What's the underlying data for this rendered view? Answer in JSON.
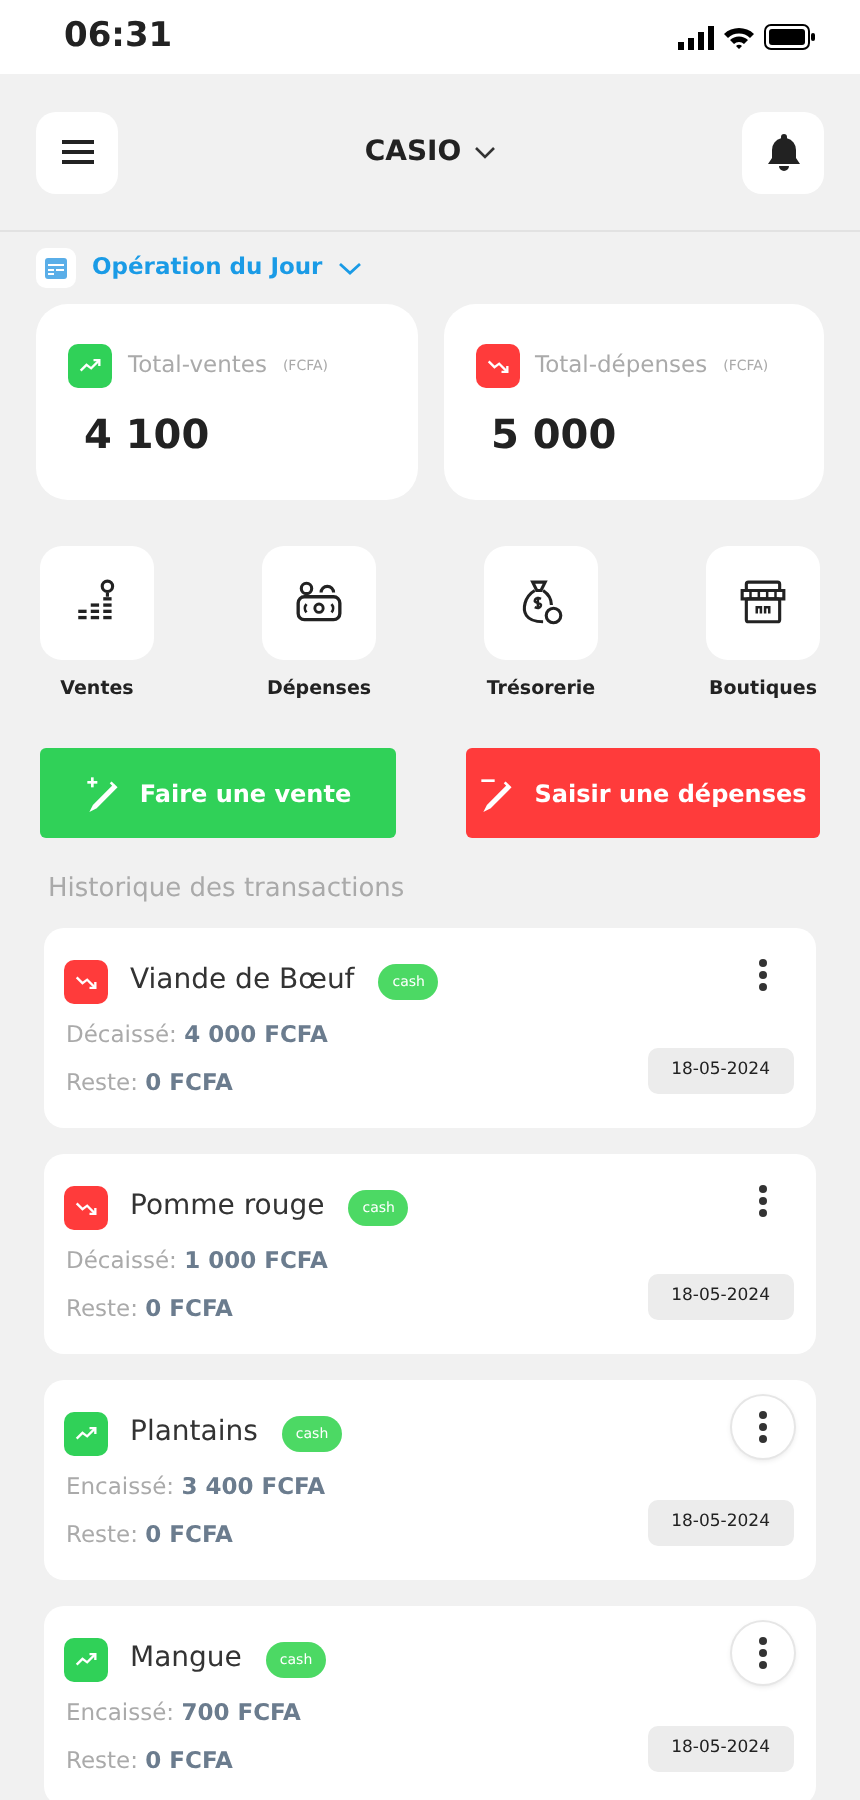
{
  "status_bar": {
    "time": "06:31"
  },
  "header": {
    "shop": "CASIO"
  },
  "period": {
    "label": "Opération du Jour"
  },
  "totals": [
    {
      "kind": "sale",
      "label": "Total-ventes",
      "unit": "(FCFA)",
      "value": "4 100"
    },
    {
      "kind": "expense",
      "label": "Total-dépenses",
      "unit": "(FCFA)",
      "value": "5 000"
    }
  ],
  "shortcuts": [
    {
      "kind": "sales",
      "label": "Ventes"
    },
    {
      "kind": "expenses",
      "label": "Dépenses"
    },
    {
      "kind": "treasury",
      "label": "Trésorerie"
    },
    {
      "kind": "shops",
      "label": "Boutiques"
    }
  ],
  "actions": [
    {
      "kind": "sale",
      "label": "Faire une vente"
    },
    {
      "kind": "expense",
      "label": "Saisir une dépenses"
    }
  ],
  "history_title": "Historique des transactions",
  "transactions": [
    {
      "kind": "expense",
      "name": "Viande de Bœuf",
      "tag": "cash",
      "amount_label": "Décaissé:",
      "amount": "4 000 FCFA",
      "rest_label": "Reste:",
      "rest": "0 FCFA",
      "date": "18-05-2024",
      "menu_outlined": false
    },
    {
      "kind": "expense",
      "name": "Pomme rouge",
      "tag": "cash",
      "amount_label": "Décaissé:",
      "amount": "1 000 FCFA",
      "rest_label": "Reste:",
      "rest": "0 FCFA",
      "date": "18-05-2024",
      "menu_outlined": false
    },
    {
      "kind": "sale",
      "name": "Plantains",
      "tag": "cash",
      "amount_label": "Encaissé:",
      "amount": "3 400 FCFA",
      "rest_label": "Reste:",
      "rest": "0 FCFA",
      "date": "18-05-2024",
      "menu_outlined": true
    },
    {
      "kind": "sale",
      "name": "Mangue",
      "tag": "cash",
      "amount_label": "Encaissé:",
      "amount": "700 FCFA",
      "rest_label": "Reste:",
      "rest": "0 FCFA",
      "date": "18-05-2024",
      "menu_outlined": true
    }
  ]
}
